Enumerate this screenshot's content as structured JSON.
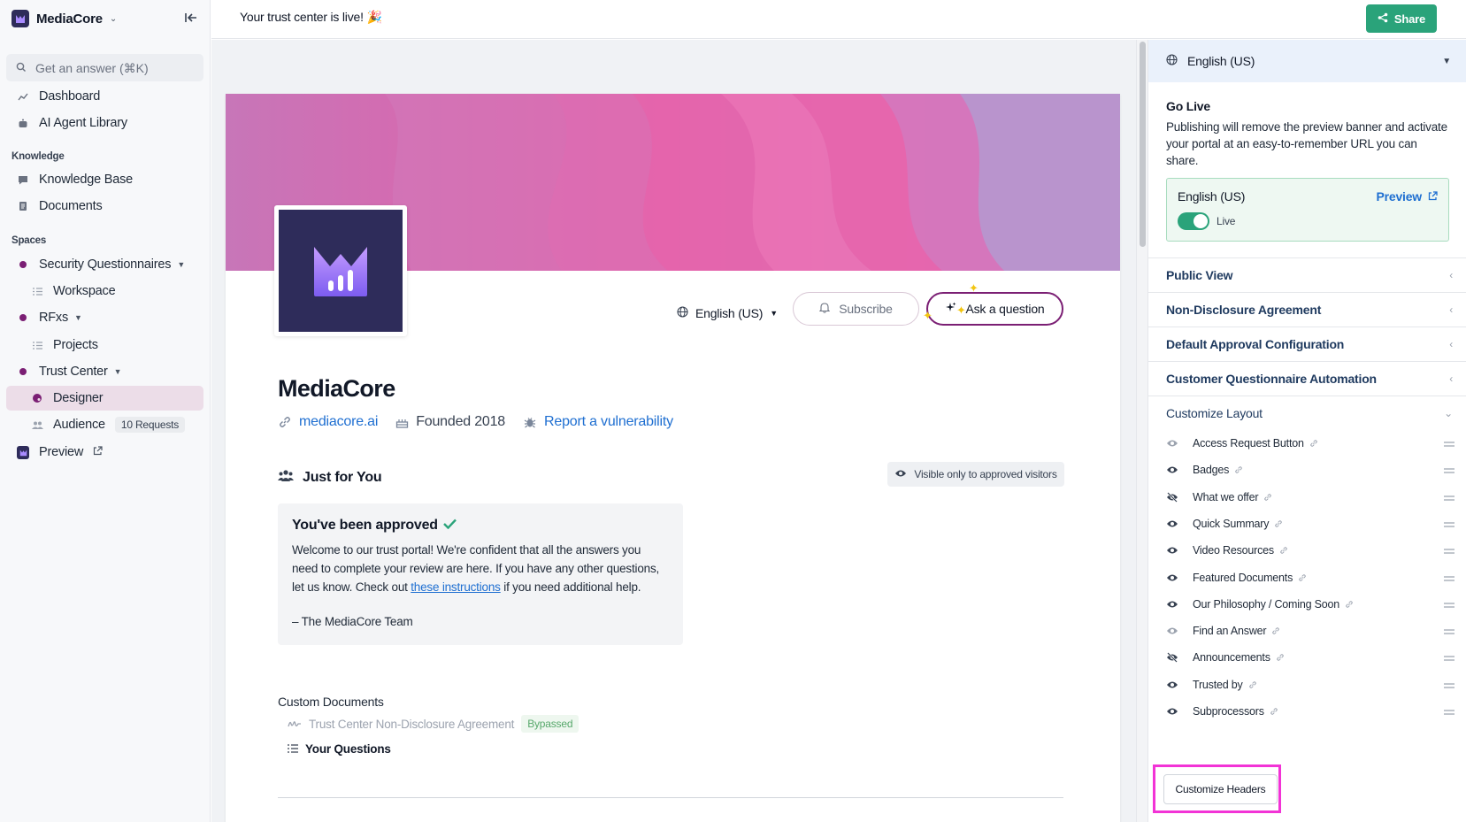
{
  "sidebar": {
    "brand": "MediaCore",
    "search_placeholder": "Get an answer (⌘K)",
    "items_top": [
      {
        "label": "Dashboard",
        "icon": "chart-icon"
      },
      {
        "label": "AI Agent Library",
        "icon": "robot-icon"
      }
    ],
    "knowledge_label": "Knowledge",
    "knowledge_items": [
      {
        "label": "Knowledge Base",
        "icon": "chat-icon"
      },
      {
        "label": "Documents",
        "icon": "document-icon"
      }
    ],
    "spaces_label": "Spaces",
    "security_questionnaires": "Security Questionnaires",
    "workspace": "Workspace",
    "rfxs": "RFxs",
    "projects": "Projects",
    "trust_center": "Trust Center",
    "designer": "Designer",
    "audience": "Audience",
    "audience_badge": "10 Requests",
    "preview": "Preview"
  },
  "topbar": {
    "banner": "Your trust center is live! 🎉",
    "share_label": "Share"
  },
  "trust_page": {
    "language": "English (US)",
    "subscribe_label": "Subscribe",
    "ask_label": "Ask a question",
    "company_name": "MediaCore",
    "website": "mediacore.ai",
    "founded": "Founded 2018",
    "report_link": "Report a vulnerability",
    "just_for_you": "Just for You",
    "visible_note": "Visible only to approved visitors",
    "approved_title": "You've been approved",
    "approved_body_1": "Welcome to our trust portal! We're confident that all the answers you need to complete your review are here. If you have any other questions, let us know. Check out",
    "approved_link": "these instructions",
    "approved_body_2": "if you need additional help.",
    "approved_sign": "– The MediaCore Team",
    "custom_documents": "Custom Documents",
    "nda_doc": "Trust Center Non-Disclosure Agreement",
    "nda_status": "Bypassed",
    "your_questions": "Your Questions"
  },
  "right_panel": {
    "language": "English (US)",
    "go_live_title": "Go Live",
    "go_live_desc": "Publishing will remove the preview banner and activate your portal at an easy-to-remember URL you can share.",
    "live_language": "English (US)",
    "preview_label": "Preview",
    "live_label": "Live",
    "live_toggle": true,
    "sections": [
      "Public View",
      "Non-Disclosure Agreement",
      "Default Approval Configuration",
      "Customer Questionnaire Automation"
    ],
    "customize_layout": "Customize Layout",
    "layout_items": [
      {
        "label": "Access Request Button",
        "visible": "partial"
      },
      {
        "label": "Badges",
        "visible": "yes"
      },
      {
        "label": "What we offer",
        "visible": "hidden"
      },
      {
        "label": "Quick Summary",
        "visible": "yes"
      },
      {
        "label": "Video Resources",
        "visible": "yes"
      },
      {
        "label": "Featured Documents",
        "visible": "yes"
      },
      {
        "label": "Our Philosophy / Coming Soon",
        "visible": "yes"
      },
      {
        "label": "Find an Answer",
        "visible": "partial"
      },
      {
        "label": "Announcements",
        "visible": "hidden"
      },
      {
        "label": "Trusted by",
        "visible": "yes"
      },
      {
        "label": "Subprocessors",
        "visible": "yes"
      }
    ],
    "customize_headers": "Customize Headers"
  },
  "colors": {
    "brand_purple": "#7b1f74",
    "accent_green": "#2aa37a",
    "link_blue": "#1f6fd1",
    "highlight_magenta": "#f233d6"
  }
}
